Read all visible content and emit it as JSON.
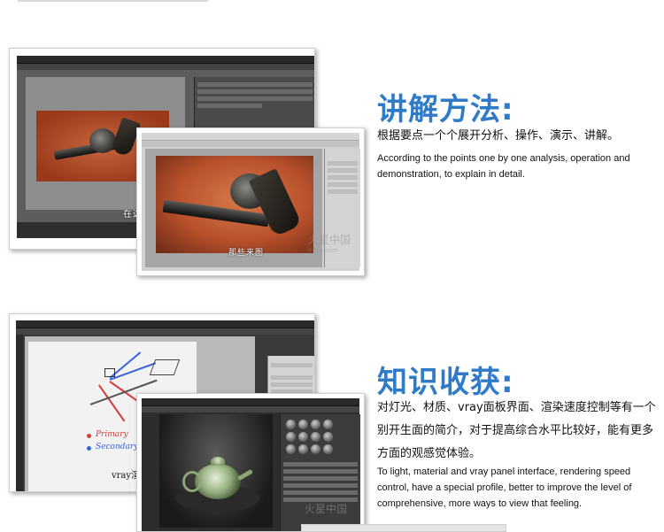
{
  "section1": {
    "heading": "讲解方法:",
    "cn_text": "根据要点一个个展开分析、操作、演示、讲解。",
    "en_text": "According to the points one by one analysis, operation and demonstration, to explain in detail."
  },
  "section2": {
    "heading": "知识收获:",
    "cn_text": "对灯光、材质、vray面板界面、渲染速度控制等有一个别开生面的简介，对于提高综合水平比较好，能有更多方面的观感觉体验。",
    "en_text": "To light, material and vray panel interface, rendering speed control, have a special profile, better to improve the level of comprehensive, more ways to view that feeling."
  },
  "screens": {
    "s1_caption": "在这",
    "s2_caption": "那些来图",
    "s3_legend1": "Primary",
    "s3_legend2": "Secondary",
    "s3_caption": "vray渲染"
  },
  "watermark": {
    "main": "火星中国",
    "sub": "hxsd.com",
    "main2": "火星中国"
  },
  "colors": {
    "heading": "#2f7bc8",
    "photo_bg": "#b8502c",
    "selection": "#3c7fd6"
  }
}
